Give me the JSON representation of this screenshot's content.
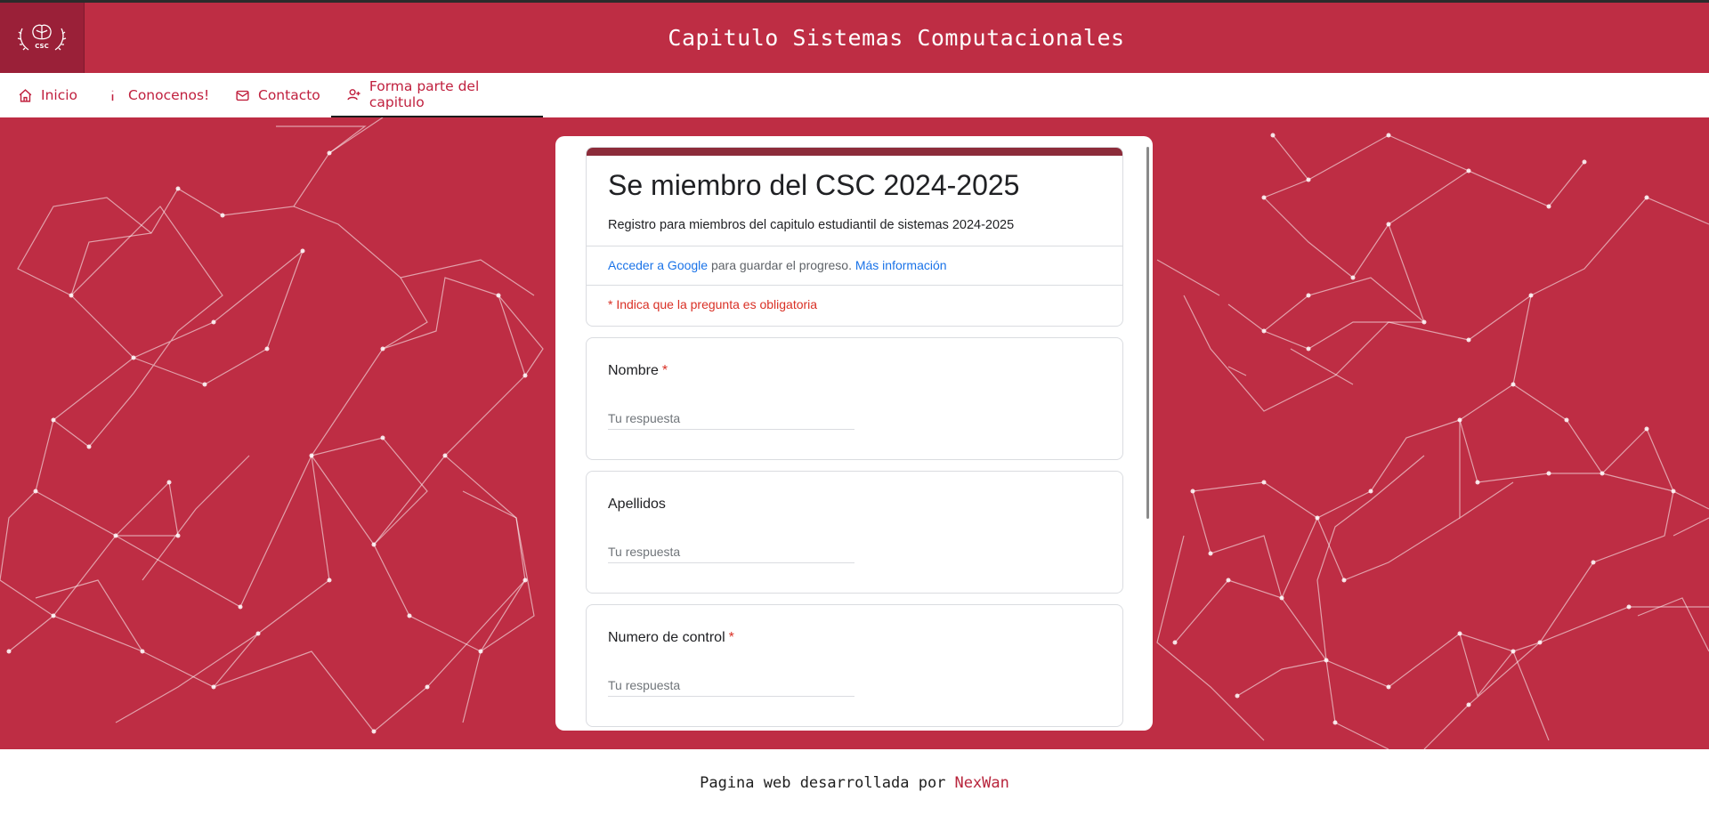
{
  "header": {
    "title": "Capitulo Sistemas Computacionales",
    "logo_text": "CSC"
  },
  "nav": {
    "items": [
      {
        "label": "Inicio",
        "icon": "home-icon"
      },
      {
        "label": "Conocenos!",
        "icon": "info-icon"
      },
      {
        "label": "Contacto",
        "icon": "mail-icon"
      },
      {
        "label": "Forma parte del capitulo",
        "icon": "user-add-icon",
        "active": true
      }
    ]
  },
  "form": {
    "title": "Se miembro del CSC 2024-2025",
    "description": "Registro para miembros del capitulo estudiantil de sistemas 2024-2025",
    "signin_link": "Acceder a Google",
    "signin_text": " para guardar el progreso. ",
    "more_info_link": "Más información",
    "required_note": "* Indica que la pregunta es obligatoria",
    "questions": [
      {
        "label": "Nombre",
        "required": "*",
        "placeholder": "Tu respuesta"
      },
      {
        "label": "Apellidos",
        "required": "",
        "placeholder": "Tu respuesta"
      },
      {
        "label": "Numero de control",
        "required": "*",
        "placeholder": "Tu respuesta"
      }
    ]
  },
  "footer": {
    "text": "Pagina web desarrollada por",
    "brand": "NexWan"
  },
  "colors": {
    "primary": "#be2d44",
    "logo_bg": "#9a2038",
    "form_band": "#8c2c3a",
    "link": "#1a73e8",
    "required": "#d93025"
  }
}
